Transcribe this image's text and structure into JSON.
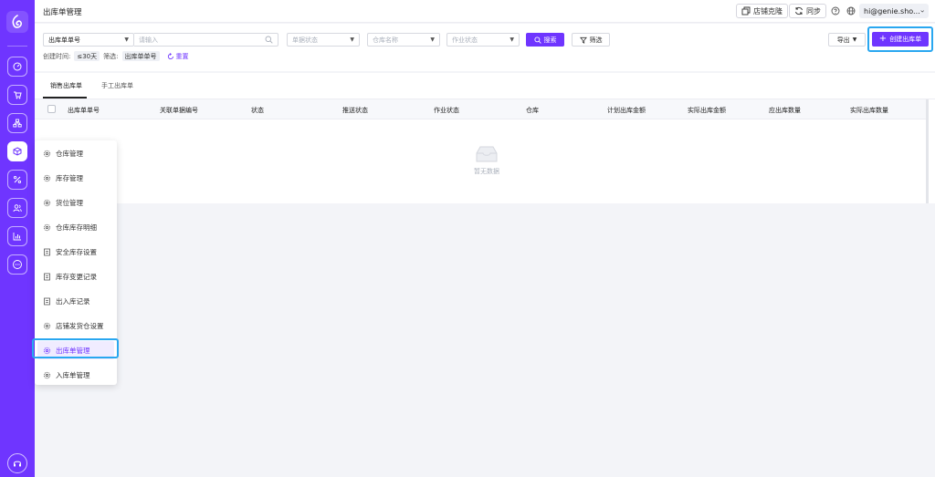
{
  "header": {
    "title": "出库单管理",
    "store_clone_label": "店铺克隆",
    "sync_label": "同步",
    "user_label": "hi@genie.sho..."
  },
  "filters": {
    "order_type": "出库单单号",
    "search_placeholder": "请输入",
    "doc_status_placeholder": "单据状态",
    "warehouse_placeholder": "仓库名称",
    "job_status_placeholder": "作业状态",
    "search_btn": "搜索",
    "filter_btn": "筛选",
    "export_btn": "导出",
    "create_btn": "创建出库单",
    "created_label": "创建时间:",
    "created_value": "≤30天",
    "filter_label": "筛选:",
    "filter_value": "出库单单号",
    "reset_label": "重置"
  },
  "tabs": [
    {
      "label": "销售出库单"
    },
    {
      "label": "手工出库单"
    }
  ],
  "table": {
    "columns": [
      "出库单单号",
      "关联单据编号",
      "状态",
      "推送状态",
      "作业状态",
      "仓库",
      "计划出库金额",
      "实际出库金额",
      "应出库数量",
      "实际出库数量"
    ],
    "empty_text": "暂无数据"
  },
  "menu": {
    "items": [
      {
        "label": "仓库管理",
        "icon": "gear-icon"
      },
      {
        "label": "库存管理",
        "icon": "gear-icon"
      },
      {
        "label": "货位管理",
        "icon": "gear-icon"
      },
      {
        "label": "仓库库存明细",
        "icon": "gear-icon"
      },
      {
        "label": "安全库存设置",
        "icon": "document-icon"
      },
      {
        "label": "库存变更记录",
        "icon": "document-icon"
      },
      {
        "label": "出入库记录",
        "icon": "document-icon"
      },
      {
        "label": "店铺发货仓设置",
        "icon": "gear-icon"
      },
      {
        "label": "出库单管理",
        "icon": "gear-icon"
      },
      {
        "label": "入库单管理",
        "icon": "gear-icon"
      }
    ]
  },
  "colors": {
    "brand": "#6f35ff",
    "highlight": "#29a7f0"
  }
}
